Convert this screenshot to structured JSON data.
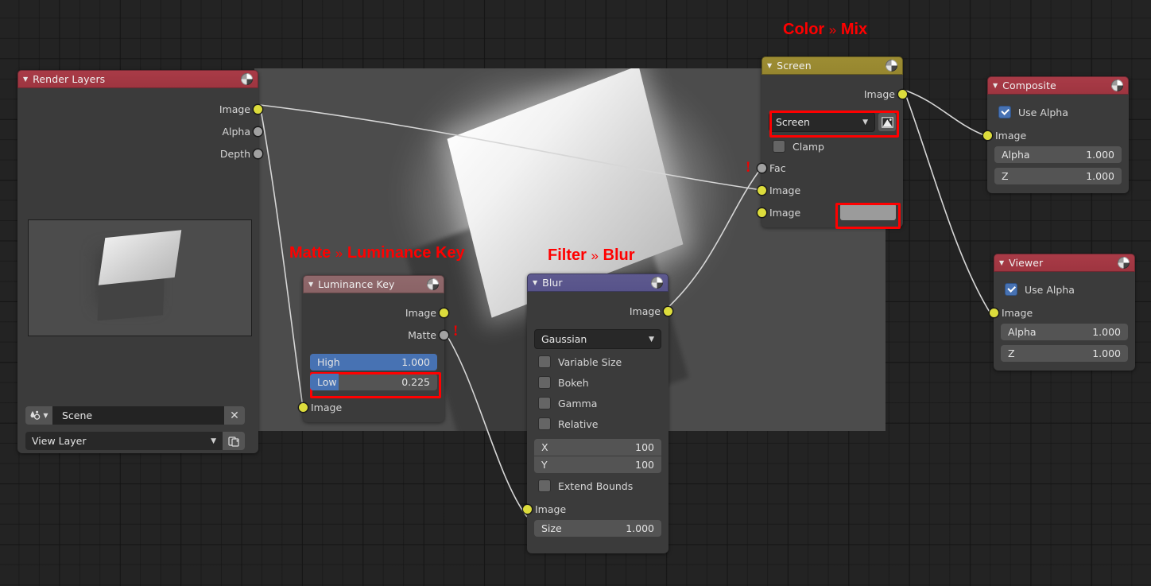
{
  "editor": {
    "background_color": "#232323",
    "grid_line_color": "#171717",
    "annotation_color": "#ff0000"
  },
  "annotations": [
    {
      "id": "annot-mix",
      "prefix": "Color",
      "sep": "»",
      "suffix": "Mix"
    },
    {
      "id": "annot-luminancekey",
      "prefix": "Matte",
      "sep": "»",
      "suffix": "Luminance Key"
    },
    {
      "id": "annot-blur",
      "prefix": "Filter",
      "sep": "»",
      "suffix": "Blur"
    }
  ],
  "nodes": {
    "render_layers": {
      "title": "Render Layers",
      "header_color": "#a93b47",
      "outputs": [
        {
          "label": "Image",
          "socket": "yellow"
        },
        {
          "label": "Alpha",
          "socket": "gray"
        },
        {
          "label": "Depth",
          "socket": "gray"
        }
      ],
      "scene_field": {
        "value": "Scene",
        "clear_label": "✕"
      },
      "view_layer_field": {
        "value": "View Layer"
      }
    },
    "luminance_key": {
      "title": "Luminance Key",
      "header_color": "#90696c",
      "outputs": [
        {
          "label": "Image",
          "socket": "yellow"
        },
        {
          "label": "Matte",
          "socket": "gray",
          "warning": "!"
        }
      ],
      "properties": [
        {
          "label": "High",
          "value": "1.000",
          "fill_percent": 100
        },
        {
          "label": "Low",
          "value": "0.225",
          "fill_percent": 22.5,
          "highlighted": true
        }
      ],
      "inputs": [
        {
          "label": "Image",
          "socket": "yellow"
        }
      ]
    },
    "blur": {
      "title": "Blur",
      "header_color": "#5e5a8f",
      "outputs": [
        {
          "label": "Image",
          "socket": "yellow"
        }
      ],
      "filter_type": "Gaussian",
      "checkboxes": [
        {
          "label": "Variable Size",
          "checked": false
        },
        {
          "label": "Bokeh",
          "checked": false
        },
        {
          "label": "Gamma",
          "checked": false
        },
        {
          "label": "Relative",
          "checked": false
        }
      ],
      "sizes": [
        {
          "label": "X",
          "value": "100"
        },
        {
          "label": "Y",
          "value": "100"
        }
      ],
      "extend_bounds": {
        "label": "Extend Bounds",
        "checked": false
      },
      "inputs": [
        {
          "label": "Image",
          "socket": "yellow"
        },
        {
          "label": "Size",
          "value": "1.000",
          "socket": "gray"
        }
      ]
    },
    "mix": {
      "title": "Screen",
      "header_color": "#9d8d33",
      "outputs": [
        {
          "label": "Image",
          "socket": "yellow"
        }
      ],
      "blend_mode": "Screen",
      "blend_mode_highlighted": true,
      "image_toggle_icon": "image-toggle-icon",
      "clamp": {
        "label": "Clamp",
        "checked": false
      },
      "inputs": [
        {
          "label": "Fac",
          "socket": "gray",
          "warning": "!"
        },
        {
          "label": "Image",
          "socket": "yellow"
        },
        {
          "label": "Image",
          "socket": "yellow",
          "swatch": "#9b9b9b",
          "swatch_highlighted": true
        }
      ]
    },
    "composite": {
      "title": "Composite",
      "header_color": "#a93b47",
      "use_alpha": {
        "label": "Use Alpha",
        "checked": true
      },
      "inputs": [
        {
          "label": "Image",
          "socket": "yellow"
        },
        {
          "label": "Alpha",
          "value": "1.000",
          "socket": "gray"
        },
        {
          "label": "Z",
          "value": "1.000",
          "socket": "gray"
        }
      ]
    },
    "viewer": {
      "title": "Viewer",
      "header_color": "#a93b47",
      "use_alpha": {
        "label": "Use Alpha",
        "checked": true
      },
      "inputs": [
        {
          "label": "Image",
          "socket": "yellow"
        },
        {
          "label": "Alpha",
          "value": "1.000",
          "socket": "gray"
        },
        {
          "label": "Z",
          "value": "1.000",
          "socket": "gray"
        }
      ]
    }
  }
}
